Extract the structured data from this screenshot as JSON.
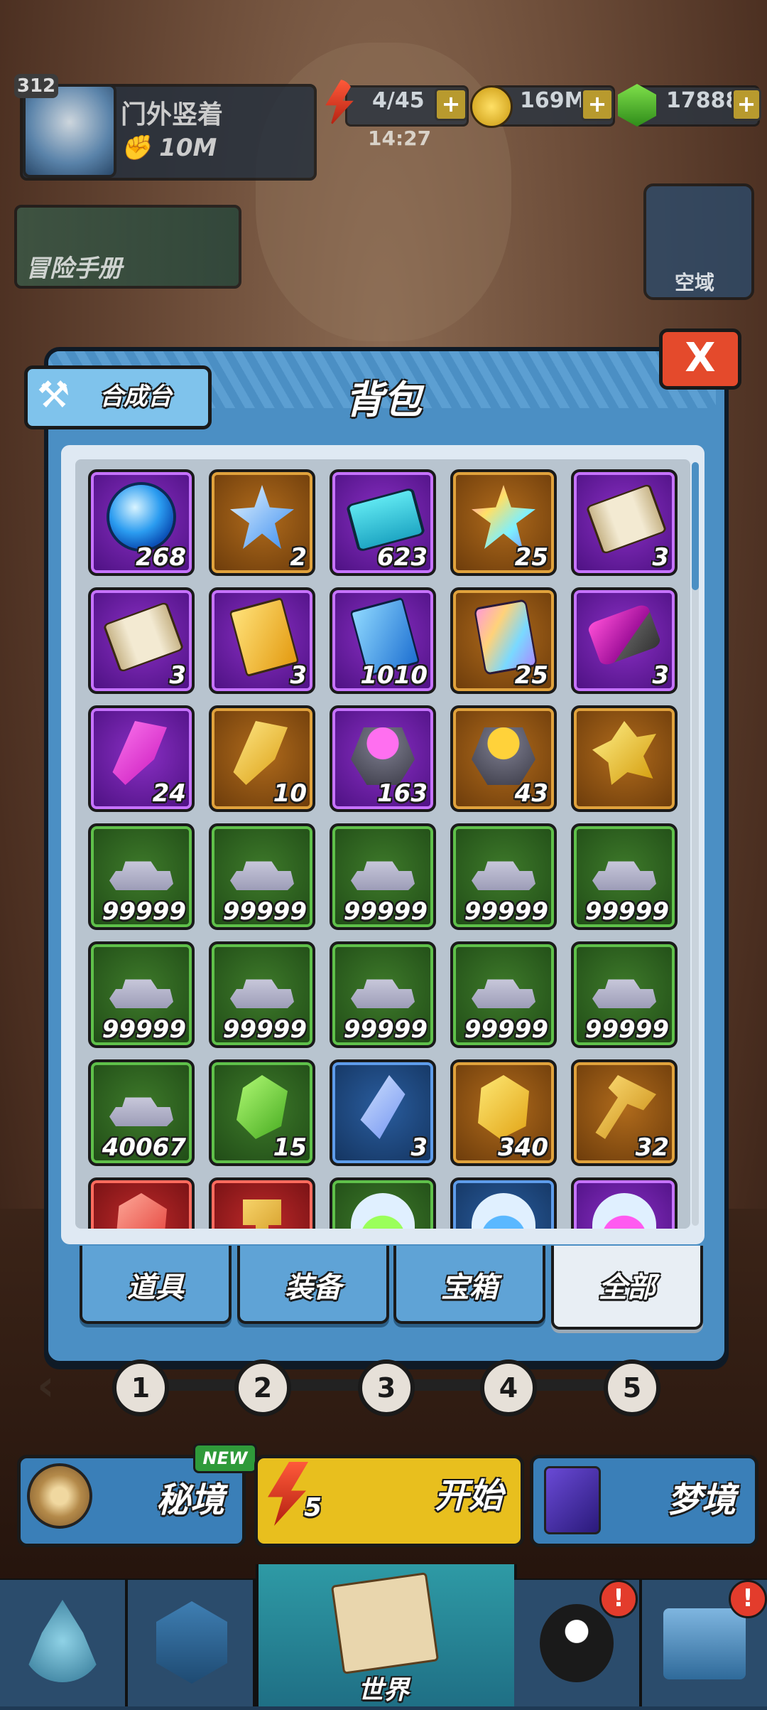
{
  "player": {
    "level": "312",
    "name": "门外竖着",
    "power": "10M"
  },
  "resources": {
    "energy": "4/45",
    "energy_timer": "14:27",
    "gold": "169M",
    "gems": "17888",
    "plus": "+"
  },
  "side_buttons": {
    "manual": "冒险手册",
    "kongyu": "空域"
  },
  "panel": {
    "title": "背包",
    "craft_label": "合成台",
    "close_label": "X"
  },
  "items": [
    {
      "rarity": "purple",
      "icon": "blue-orb-icon",
      "count": "268"
    },
    {
      "rarity": "orange",
      "icon": "blue-star-icon",
      "count": "2"
    },
    {
      "rarity": "purple",
      "icon": "ticket-icon",
      "count": "623"
    },
    {
      "rarity": "orange",
      "icon": "rainbow-star-icon",
      "count": "25"
    },
    {
      "rarity": "purple",
      "icon": "scroll-icon",
      "count": "3"
    },
    {
      "rarity": "purple",
      "icon": "scroll-icon",
      "count": "3"
    },
    {
      "rarity": "purple",
      "icon": "gold-packet-icon",
      "count": "3"
    },
    {
      "rarity": "purple",
      "icon": "blue-packet-icon",
      "count": "1010"
    },
    {
      "rarity": "orange",
      "icon": "card-pack-icon",
      "count": "25"
    },
    {
      "rarity": "purple",
      "icon": "purple-stone-icon",
      "count": "3"
    },
    {
      "rarity": "purple",
      "icon": "pink-crystal-icon",
      "count": "24"
    },
    {
      "rarity": "orange",
      "icon": "gold-crystal-icon",
      "count": "10"
    },
    {
      "rarity": "purple",
      "icon": "purple-ore-icon",
      "count": "163"
    },
    {
      "rarity": "orange",
      "icon": "gold-ore-icon",
      "count": "43"
    },
    {
      "rarity": "orange",
      "icon": "gold-shard-icon",
      "count": ""
    },
    {
      "rarity": "green",
      "icon": "silver-ingot-icon",
      "count": "99999"
    },
    {
      "rarity": "green",
      "icon": "silver-ingot-icon",
      "count": "99999"
    },
    {
      "rarity": "green",
      "icon": "silver-ingot-icon",
      "count": "99999"
    },
    {
      "rarity": "green",
      "icon": "silver-ingot-icon",
      "count": "99999"
    },
    {
      "rarity": "green",
      "icon": "silver-ingot-icon",
      "count": "99999"
    },
    {
      "rarity": "green",
      "icon": "silver-ingot-icon",
      "count": "99999"
    },
    {
      "rarity": "green",
      "icon": "silver-ingot-icon",
      "count": "99999"
    },
    {
      "rarity": "green",
      "icon": "silver-ingot-icon",
      "count": "99999"
    },
    {
      "rarity": "green",
      "icon": "silver-ingot-icon",
      "count": "99999"
    },
    {
      "rarity": "green",
      "icon": "silver-ingot-icon",
      "count": "99999"
    },
    {
      "rarity": "green",
      "icon": "silver-ingot-icon",
      "count": "40067"
    },
    {
      "rarity": "green",
      "icon": "green-gem-icon",
      "count": "15"
    },
    {
      "rarity": "blue",
      "icon": "blue-gem-icon",
      "count": "3"
    },
    {
      "rarity": "orange",
      "icon": "gold-gem-icon",
      "count": "340"
    },
    {
      "rarity": "orange",
      "icon": "hammer-icon",
      "count": "32"
    },
    {
      "rarity": "red",
      "icon": "red-gem-icon",
      "count": ""
    },
    {
      "rarity": "red",
      "icon": "red-hammer-icon",
      "count": ""
    },
    {
      "rarity": "green",
      "icon": "green-potion-icon",
      "count": ""
    },
    {
      "rarity": "blue",
      "icon": "blue-potion-icon",
      "count": ""
    },
    {
      "rarity": "purple",
      "icon": "purple-potion-icon",
      "count": ""
    }
  ],
  "tabs": [
    {
      "label": "道具",
      "active": false
    },
    {
      "label": "装备",
      "active": false
    },
    {
      "label": "宝箱",
      "active": false
    },
    {
      "label": "全部",
      "active": true
    }
  ],
  "stages": [
    "1",
    "2",
    "3",
    "4",
    "5"
  ],
  "actions": {
    "secret": "秘境",
    "new_badge": "NEW",
    "start": "开始",
    "start_cost": "5",
    "dream": "梦境"
  },
  "nav": {
    "world": "世界",
    "alert": "!"
  },
  "colors": {
    "panel_blue": "#4b8fc4",
    "close_red": "#e44a2c",
    "purple": "#8a2fc4",
    "orange": "#b06b1c",
    "green": "#3e7a2a",
    "blue": "#2a5d9e",
    "red": "#c02a2a"
  }
}
